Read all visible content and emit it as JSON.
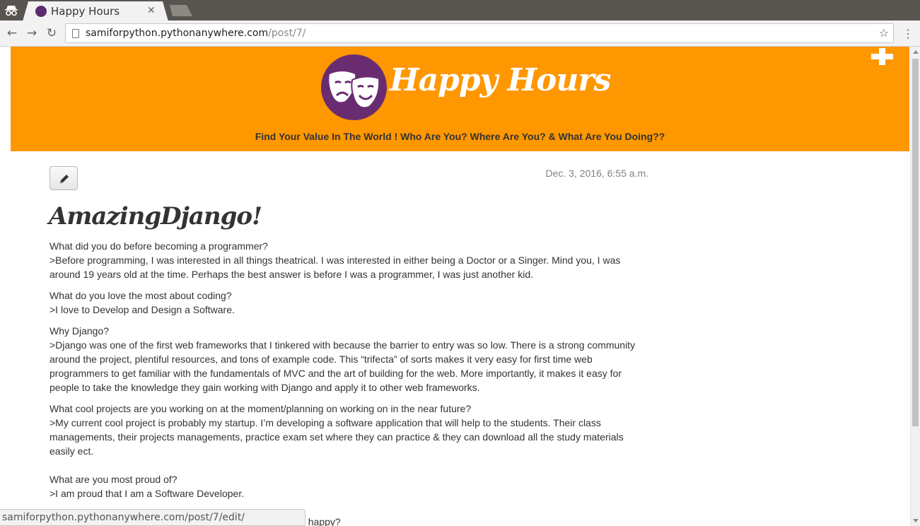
{
  "browser": {
    "tab": {
      "title": "Happy Hours",
      "close_glyph": "✕"
    },
    "nav": {
      "back_glyph": "←",
      "forward_glyph": "→",
      "reload_glyph": "↻"
    },
    "address": {
      "host": "samiforpython.pythonanywhere.com",
      "path": "/post/7/"
    },
    "star_glyph": "☆",
    "menu_glyph": "⋮",
    "status_url": "samiforpython.pythonanywhere.com/post/7/edit/"
  },
  "header": {
    "site_title": "Happy Hours",
    "tagline": "Find Your Value In The World ! Who Are You? Where Are You? & What Are You Doing??",
    "logo_icon": "theater-masks-icon",
    "add_icon": "plus-icon"
  },
  "colors": {
    "header_bg": "#ff9700",
    "logo_circle": "#6a2c70",
    "text": "#333333",
    "date": "#828282"
  },
  "post": {
    "edit_icon": "pencil-icon",
    "date": "Dec. 3, 2016, 6:55 a.m.",
    "title": "AmazingDjango!",
    "paragraphs": [
      {
        "lines": [
          "What did you do before becoming a programmer?",
          ">Before programming, I was interested in all things theatrical. I was interested in either being a Doctor or a Singer. Mind you, I was",
          "around 19 years old at the time. Perhaps the best answer is before I was a programmer, I was just another kid."
        ]
      },
      {
        "lines": [
          "What do you love the most about coding?",
          ">I love to Develop and Design a Software."
        ]
      },
      {
        "lines": [
          "Why Django?",
          ">Django was one of the first web frameworks that I tinkered with because the barrier to entry was so low. There is a strong community",
          "around the project, plentiful resources, and tons of example code. This “trifecta” of sorts makes it very easy for first time web",
          "programmers to get familiar with the fundamentals of MVC and the art of building for the web. More importantly, it makes it easy for",
          "people to take the knowledge they gain working with Django and apply it to other web frameworks."
        ]
      },
      {
        "lines": [
          "What cool projects are you working on at the moment/planning on working on in the near future?",
          ">My current cool project is probably my startup. I’m developing a software application that will help to the students. Their class",
          "managements, their projects managements, practice exam set where they can practice & they can download all the study materials",
          "easily ect."
        ]
      },
      {
        "lines": [
          "What are you most proud of?",
          ">I am proud that I am a Software Developer."
        ]
      },
      {
        "lines": [
          "What does your success depends on and what makes you happy?"
        ]
      }
    ]
  }
}
